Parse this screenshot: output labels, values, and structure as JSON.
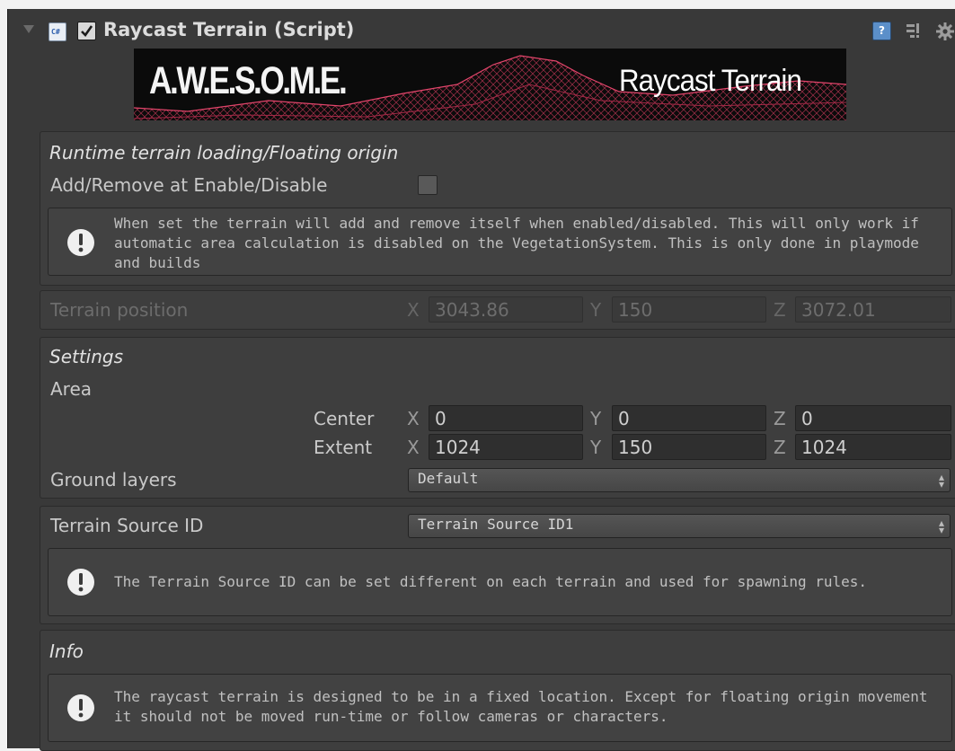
{
  "component": {
    "title": "Raycast Terrain (Script)",
    "enabled": true
  },
  "banner": {
    "awesome": "A.W.E.S.O.M.E.",
    "product": "Raycast Terrain"
  },
  "runtime": {
    "heading": "Runtime terrain loading/Floating origin",
    "toggle_label": "Add/Remove at Enable/Disable",
    "toggle_checked": false,
    "help": "When set the terrain will add and remove itself when enabled/disabled. This will only work if automatic area calculation is disabled on the VegetationSystem. This is only done in playmode and builds"
  },
  "terrain_position": {
    "label": "Terrain position",
    "x_label": "X",
    "x": "3043.86",
    "y_label": "Y",
    "y": "150",
    "z_label": "Z",
    "z": "3072.01"
  },
  "settings": {
    "heading": "Settings",
    "area_label": "Area",
    "center": {
      "label": "Center",
      "x_label": "X",
      "x": "0",
      "y_label": "Y",
      "y": "0",
      "z_label": "Z",
      "z": "0"
    },
    "extent": {
      "label": "Extent",
      "x_label": "X",
      "x": "1024",
      "y_label": "Y",
      "y": "150",
      "z_label": "Z",
      "z": "1024"
    },
    "ground_layers_label": "Ground layers",
    "ground_layers_value": "Default"
  },
  "terrain_source": {
    "label": "Terrain Source ID",
    "value": "Terrain Source ID1",
    "help": "The Terrain Source ID can be set different on each terrain and used for spawning rules."
  },
  "info": {
    "heading": "Info",
    "help": "The raycast terrain is designed to be in a fixed location. Except for floating origin movement it should not be moved run-time or follow cameras or characters."
  },
  "colors": {
    "panel": "#3e3e3e",
    "background": "#393939",
    "banner_accent": "#d8365f"
  }
}
